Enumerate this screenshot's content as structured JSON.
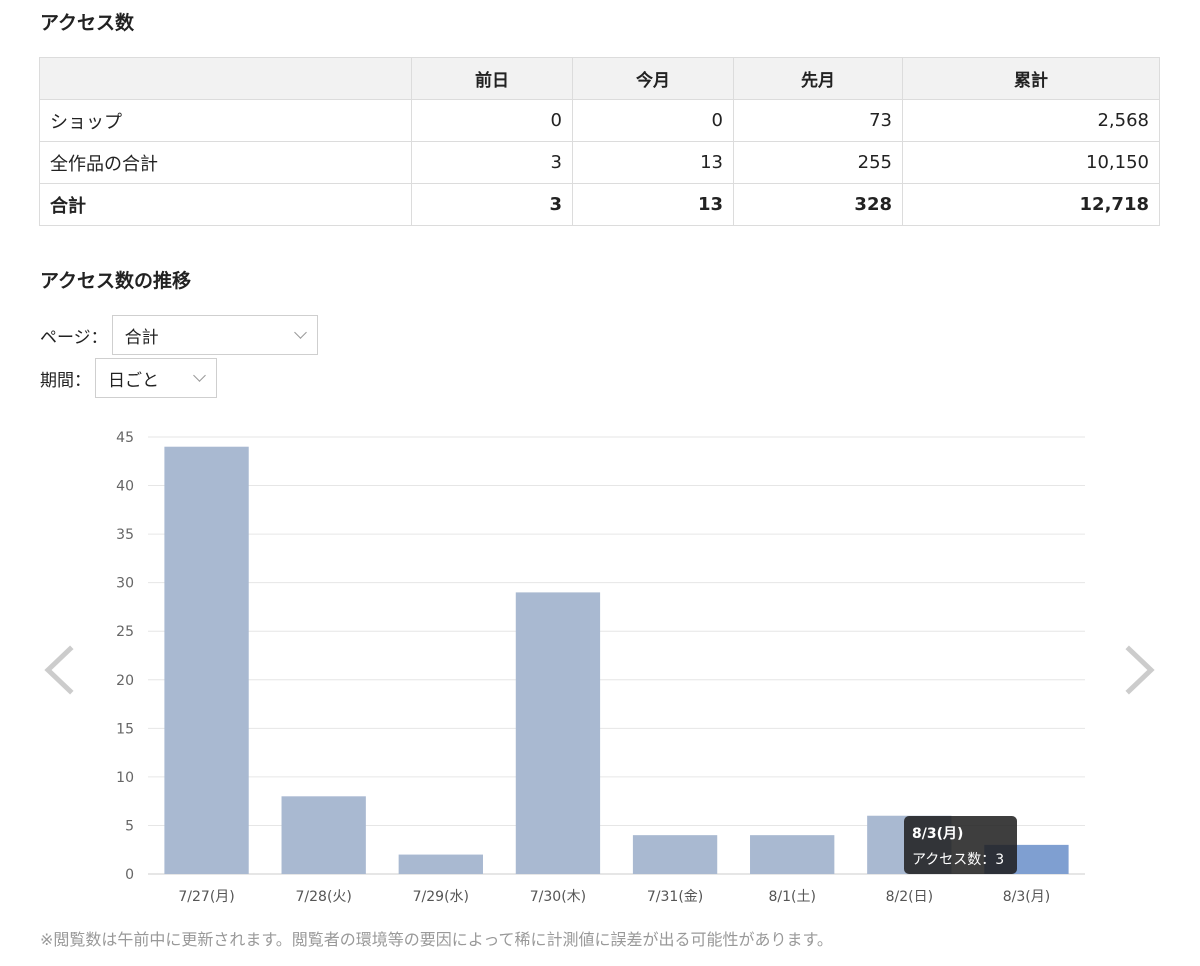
{
  "access_section": {
    "title": "アクセス数",
    "headers": [
      "",
      "前日",
      "今月",
      "先月",
      "累計"
    ],
    "rows": [
      {
        "label": "ショップ",
        "values": [
          "0",
          "0",
          "73",
          "2,568"
        ]
      },
      {
        "label": "全作品の合計",
        "values": [
          "3",
          "13",
          "255",
          "10,150"
        ]
      },
      {
        "label": "合計",
        "values": [
          "3",
          "13",
          "328",
          "12,718"
        ]
      }
    ]
  },
  "trend_section": {
    "title": "アクセス数の推移",
    "page_filter": {
      "label": "ページ：",
      "value": "合計"
    },
    "period_filter": {
      "label": "期間：",
      "value": "日ごと"
    }
  },
  "chart_data": {
    "type": "bar",
    "categories": [
      "7/27(月)",
      "7/28(火)",
      "7/29(水)",
      "7/30(木)",
      "7/31(金)",
      "8/1(土)",
      "8/2(日)",
      "8/3(月)"
    ],
    "values": [
      44,
      8,
      2,
      29,
      4,
      4,
      6,
      3
    ],
    "ylim": [
      0,
      45
    ],
    "yticks": [
      0,
      5,
      10,
      15,
      20,
      25,
      30,
      35,
      40,
      45
    ],
    "grid": true,
    "bar_color": "#a9b9d1",
    "highlight_color": "#7f9fd1",
    "highlight_index": 7
  },
  "tooltip": {
    "title": "8/3(月)",
    "body": "アクセス数：3"
  },
  "footnote": "※閲覧数は午前中に更新されます。閲覧者の環境等の要因によって稀に計測値に誤差が出る可能性があります。",
  "icons": {
    "prev": "chevron-left-icon",
    "next": "chevron-right-icon",
    "dropdown": "chevron-down-icon"
  }
}
